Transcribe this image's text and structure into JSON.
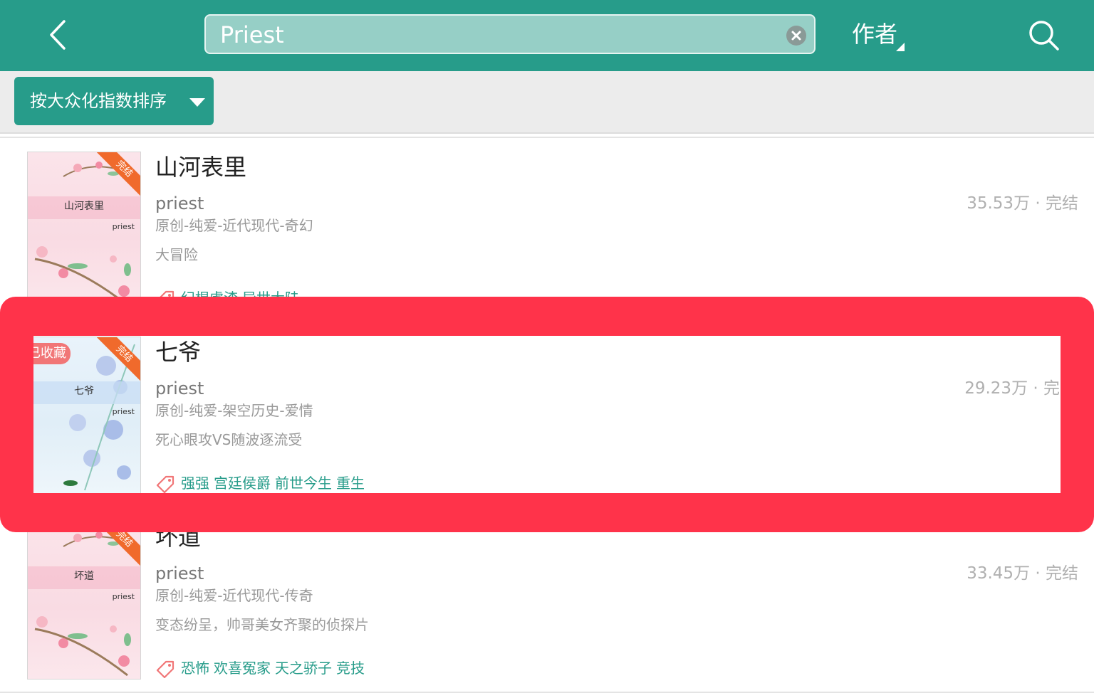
{
  "header": {
    "back_icon": "chevron-left-icon",
    "search_value": "Priest",
    "clear_icon": "clear-circle-icon",
    "search_mode": "作者",
    "search_icon": "search-icon",
    "accent_color": "#279c8a"
  },
  "sort": {
    "label": "按大众化指数排序",
    "caret_icon": "caret-down-icon"
  },
  "books": [
    {
      "title": "山河表里",
      "author": "priest",
      "stats": "35.53万 · 完结",
      "category": "原创-纯爱-近代现代-奇幻",
      "intro": "大冒险",
      "tags": [
        "纪棍虐渣",
        "异世大陆"
      ],
      "cover_title": "山河表里",
      "cover_author": "priest",
      "cover_ribbon": "完结",
      "favorited": false
    },
    {
      "title": "七爷",
      "author": "priest",
      "stats": "29.23万 · 完",
      "category": "原创-纯爱-架空历史-爱情",
      "intro": "死心眼攻VS随波逐流受",
      "tags": [
        "强强",
        "宫廷侯爵",
        "前世今生",
        "重生"
      ],
      "cover_title": "七爷",
      "cover_author": "priest",
      "cover_ribbon": "完结",
      "favorited": true,
      "favorite_label": "已收藏"
    },
    {
      "title": "坏道",
      "author": "priest",
      "stats": "33.45万 · 完结",
      "category": "原创-纯爱-近代现代-传奇",
      "intro": "变态纷呈，帅哥美女齐聚的侦探片",
      "tags": [
        "恐怖",
        "欢喜冤家",
        "天之骄子",
        "竞技"
      ],
      "cover_title": "坏道",
      "cover_author": "priest",
      "cover_ribbon": "完结",
      "favorited": false
    }
  ],
  "annotation": {
    "highlight_color": "#ff334a"
  }
}
